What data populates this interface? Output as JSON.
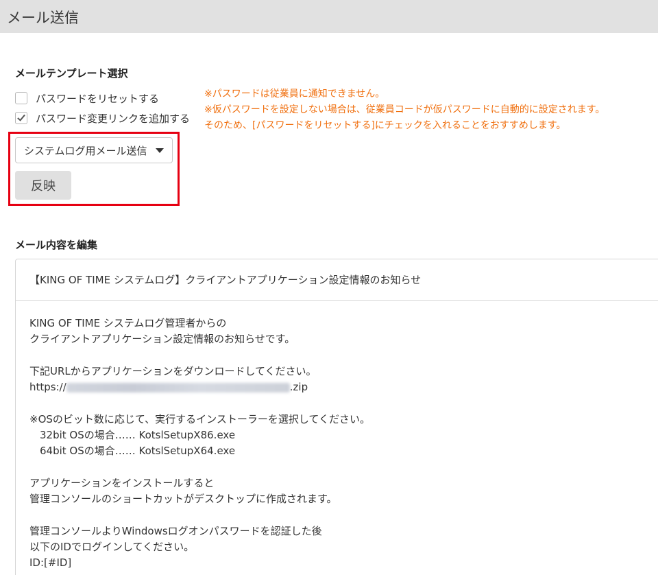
{
  "header": {
    "title": "メール送信"
  },
  "template_section": {
    "title": "メールテンプレート選択",
    "checkboxes": [
      {
        "label": "パスワードをリセットする",
        "checked": false
      },
      {
        "label": "パスワード変更リンクを追加する",
        "checked": true
      }
    ],
    "notice_lines": [
      "※パスワードは従業員に通知できません。",
      "※仮パスワードを設定しない場合は、従業員コードが仮パスワードに自動的に設定されます。",
      "そのため、[パスワードをリセットする]にチェックを入れることをおすすめします。"
    ],
    "select_value": "システムログ用メール送信",
    "apply_label": "反映"
  },
  "mail_section": {
    "title": "メール内容を編集",
    "subject": "【KING OF TIME システムログ】クライアントアプリケーション設定情報のお知らせ",
    "body": {
      "l1": "KING OF TIME システムログ管理者からの",
      "l2": "クライアントアプリケーション設定情報のお知らせです。",
      "l3": "下記URLからアプリケーションをダウンロードしてください。",
      "url_prefix": "https://",
      "url_suffix": ".zip",
      "l4": "※OSのビット数に応じて、実行するインストーラーを選択してください。",
      "l5": "　32bit OSの場合…… KotslSetupX86.exe",
      "l6": "　64bit OSの場合…… KotslSetupX64.exe",
      "l7": "アプリケーションをインストールすると",
      "l8": "管理コンソールのショートカットがデスクトップに作成されます。",
      "l9": "管理コンソールよりWindowsログオンパスワードを認証した後",
      "l10": "以下のIDでログインしてください。",
      "l11": "ID:[#ID]"
    }
  },
  "colors": {
    "notice": "#f07010",
    "highlight": "#e60012",
    "header_bg": "#e1e1e1"
  }
}
